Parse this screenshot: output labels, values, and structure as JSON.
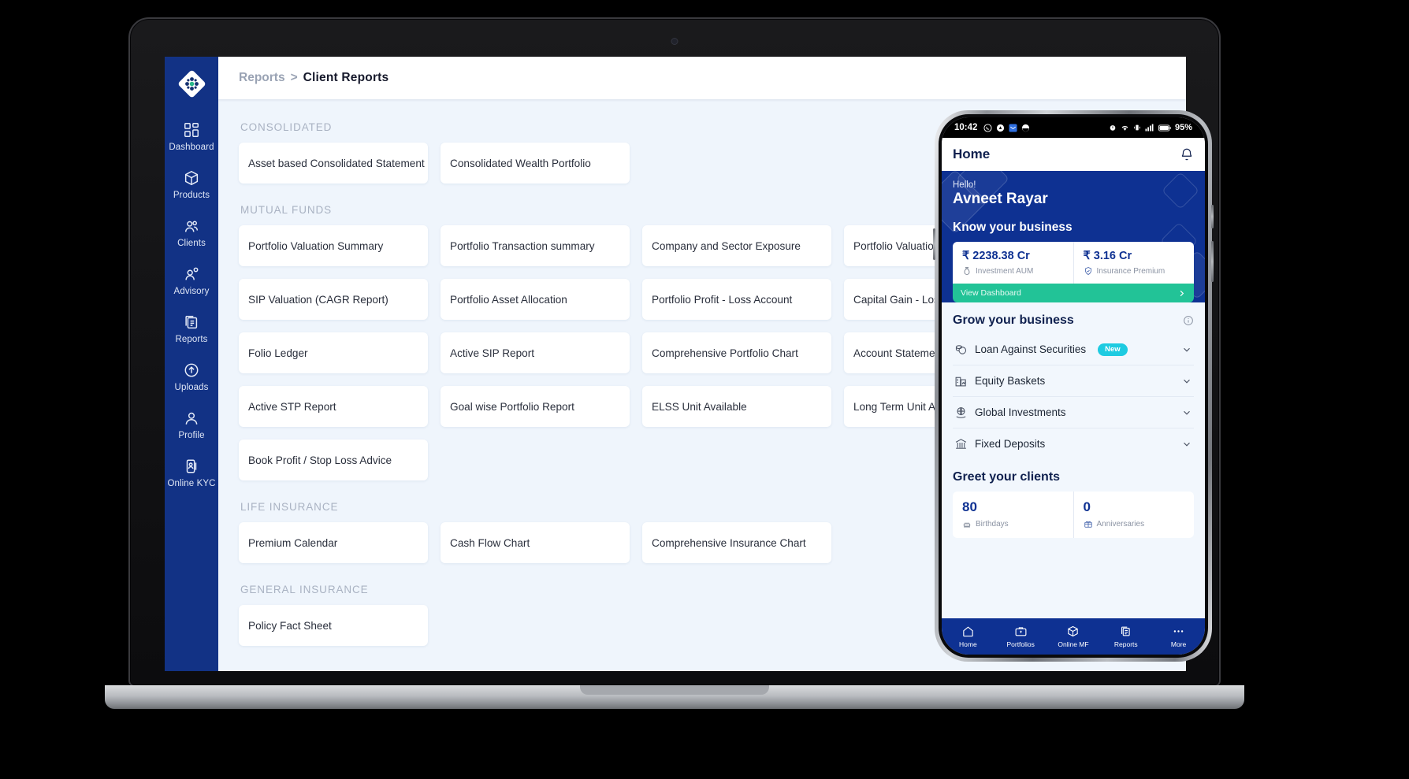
{
  "desktop": {
    "brand_logo": "diamond-logo",
    "breadcrumb": {
      "parent": "Reports",
      "separator": ">",
      "current": "Client Reports"
    },
    "sidebar": [
      {
        "label": "Dashboard",
        "icon": "grid-icon"
      },
      {
        "label": "Products",
        "icon": "box-icon"
      },
      {
        "label": "Clients",
        "icon": "people-icon"
      },
      {
        "label": "Advisory",
        "icon": "advisory-icon"
      },
      {
        "label": "Reports",
        "icon": "documents-icon"
      },
      {
        "label": "Uploads",
        "icon": "upload-circle-icon"
      },
      {
        "label": "Profile",
        "icon": "person-icon"
      },
      {
        "label": "Online KYC",
        "icon": "id-card-icon"
      }
    ],
    "sections": [
      {
        "title": "CONSOLIDATED",
        "cards": [
          "Asset based Consolidated Statement",
          "Consolidated Wealth Portfolio"
        ]
      },
      {
        "title": "MUTUAL FUNDS",
        "cards": [
          "Portfolio Valuation Summary",
          "Portfolio Transaction summary",
          "Company and Sector Exposure",
          "Portfolio Valuation (CAGR Report)",
          "SIP Valuation (CAGR Report)",
          "Portfolio Asset Allocation",
          "Portfolio Profit - Loss Account",
          "Capital Gain - Loss Report",
          "Folio Ledger",
          "Active SIP Report",
          "Comprehensive Portfolio Chart",
          "Account Statement",
          "Active STP Report",
          "Goal wise Portfolio Report",
          "ELSS Unit Available",
          "Long Term Unit Available",
          "Book Profit / Stop Loss Advice"
        ]
      },
      {
        "title": "LIFE INSURANCE",
        "cards": [
          "Premium Calendar",
          "Cash Flow Chart",
          "Comprehensive Insurance Chart"
        ]
      },
      {
        "title": "GENERAL INSURANCE",
        "cards": [
          "Policy Fact Sheet"
        ]
      }
    ]
  },
  "phone": {
    "statusbar": {
      "time": "10:42",
      "left_icons": [
        "whatsapp-icon",
        "drive-icon",
        "mail-icon",
        "chat-icon"
      ],
      "right_icons": [
        "alarm-icon",
        "wifi-icon",
        "vibrate-icon",
        "signal-icon",
        "battery-icon"
      ],
      "battery_pct": "95%"
    },
    "header": {
      "title": "Home",
      "bell": "bell-icon"
    },
    "hero": {
      "greeting": "Hello!",
      "user_name": "Avneet Rayar",
      "section_title": "Know your business",
      "stats": [
        {
          "value": "₹ 2238.38 Cr",
          "label": "Investment AUM",
          "icon": "money-bag-icon"
        },
        {
          "value": "₹ 3.16 Cr",
          "label": "Insurance Premium",
          "icon": "shield-check-icon"
        }
      ],
      "cta": {
        "label": "View Dashboard",
        "chevron": "chevron-right-icon"
      }
    },
    "grow": {
      "title": "Grow your business",
      "info_icon": "info-icon",
      "items": [
        {
          "label": "Loan Against Securities",
          "icon": "coins-icon",
          "badge": "New"
        },
        {
          "label": "Equity Baskets",
          "icon": "buildings-chart-icon",
          "badge": ""
        },
        {
          "label": "Global Investments",
          "icon": "globe-hand-icon",
          "badge": ""
        },
        {
          "label": "Fixed Deposits",
          "icon": "bank-icon",
          "badge": ""
        }
      ]
    },
    "greet": {
      "title": "Greet your clients",
      "items": [
        {
          "value": "80",
          "label": "Birthdays",
          "icon": "cake-icon"
        },
        {
          "value": "0",
          "label": "Anniversaries",
          "icon": "gift-icon"
        }
      ]
    },
    "tabbar": [
      {
        "label": "Home",
        "icon": "home-icon"
      },
      {
        "label": "Portfolios",
        "icon": "briefcase-icon"
      },
      {
        "label": "Online MF",
        "icon": "box-icon"
      },
      {
        "label": "Reports",
        "icon": "documents-icon"
      },
      {
        "label": "More",
        "icon": "ellipsis-icon"
      }
    ]
  },
  "colors": {
    "brand_blue": "#0e3192",
    "sidebar_blue": "#123285",
    "accent_green": "#22c397",
    "badge_cyan": "#1ecbe1",
    "page_bg": "#eff5fc"
  }
}
